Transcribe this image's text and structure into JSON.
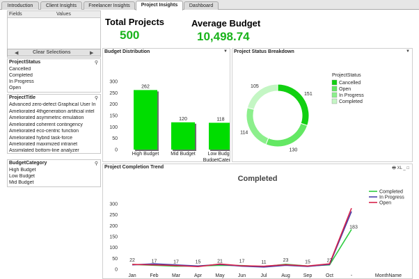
{
  "tabs": [
    {
      "label": "Introduction",
      "active": false
    },
    {
      "label": "Client Insights",
      "active": false
    },
    {
      "label": "Freelancer Insights",
      "active": false
    },
    {
      "label": "Project Insights",
      "active": true
    },
    {
      "label": "Dashboard",
      "active": false
    }
  ],
  "fields_values": {
    "fields_label": "Fields",
    "values_label": "Values"
  },
  "clear_bar": {
    "left_arrow": "◀",
    "label": "Clear Selections",
    "right_arrow": "▶"
  },
  "listboxes": {
    "project_status": {
      "title": "ProjectStatus",
      "items": [
        "Cancelled",
        "Completed",
        "In Progress",
        "Open"
      ]
    },
    "project_title": {
      "title": "ProjectTitle",
      "items": [
        "Advanced zero-defect Graphical User In",
        "Ameliorated 4thgeneration artificial intel",
        "Ameliorated asymmetric emulation",
        "Ameliorated coherent contingency",
        "Ameliorated eco-centric function",
        "Ameliorated hybrid task-force",
        "Ameliorated maximized intranet",
        "Assimilated bottom-line analyzer"
      ]
    },
    "budget_category": {
      "title": "BudgetCategory",
      "items": [
        "High Budget",
        "Low Budget",
        "Mid Budget"
      ]
    }
  },
  "kpis": {
    "total_projects": {
      "label": "Total Projects",
      "value": "500"
    },
    "average_budget": {
      "label": "Average Budget",
      "value": "10,498.74"
    }
  },
  "panels": {
    "budget_distribution": {
      "title": "Budget Distribution",
      "arrow": "▼"
    },
    "status_breakdown": {
      "title": "Project Status Breakdown",
      "arrow": "▼"
    },
    "completion_trend": {
      "title": "Project Completion Trend",
      "controls": "🖶 XL _ □"
    }
  },
  "colors": {
    "accent_green": "#19b31b",
    "bar_green": "#00dd00"
  },
  "chart_data": [
    {
      "type": "bar",
      "categories": [
        "High Budget",
        "Mid Budget",
        "Low Budget"
      ],
      "values": [
        262,
        120,
        118
      ],
      "xlabel": "BudgetCategory",
      "ylabel": "",
      "ylim": [
        0,
        300
      ],
      "yticks": [
        "0",
        "50",
        "100",
        "150",
        "200",
        "250",
        "300"
      ]
    },
    {
      "type": "pie",
      "legend_title": "ProjectStatus",
      "categories": [
        "Cancelled",
        "Open",
        "In Progress",
        "Completed"
      ],
      "values": [
        151,
        130,
        114,
        105
      ],
      "colors": [
        "#11d011",
        "#63e863",
        "#8cef8c",
        "#c4f6c4"
      ],
      "legend": "right"
    },
    {
      "type": "line",
      "title": "Completed",
      "x": [
        "Jan",
        "Feb",
        "Mar",
        "Apr",
        "May",
        "Jun",
        "Jul",
        "Aug",
        "Sep",
        "Oct",
        "-"
      ],
      "xlabel": "MonthName",
      "ylim": [
        0,
        300
      ],
      "yticks": [
        "0",
        "50",
        "100",
        "150",
        "200",
        "250",
        "300"
      ],
      "series": [
        {
          "name": "Completed",
          "color": "#2ecc40",
          "values": [
            22,
            18,
            14,
            15,
            18,
            17,
            12,
            23,
            15,
            20,
            183
          ]
        },
        {
          "name": "In Progress",
          "color": "#4a3fa8",
          "values": [
            20,
            25,
            20,
            15,
            22,
            14,
            10,
            18,
            13,
            22,
            265
          ]
        },
        {
          "name": "Open",
          "color": "#d6224a",
          "values": [
            22,
            20,
            17,
            12,
            24,
            16,
            14,
            21,
            15,
            25,
            280
          ]
        }
      ],
      "data_labels": [
        "22",
        "17",
        "17",
        "15",
        "21",
        "17",
        "11",
        "23",
        "15",
        "27",
        "183"
      ],
      "legend": "top-right"
    }
  ]
}
